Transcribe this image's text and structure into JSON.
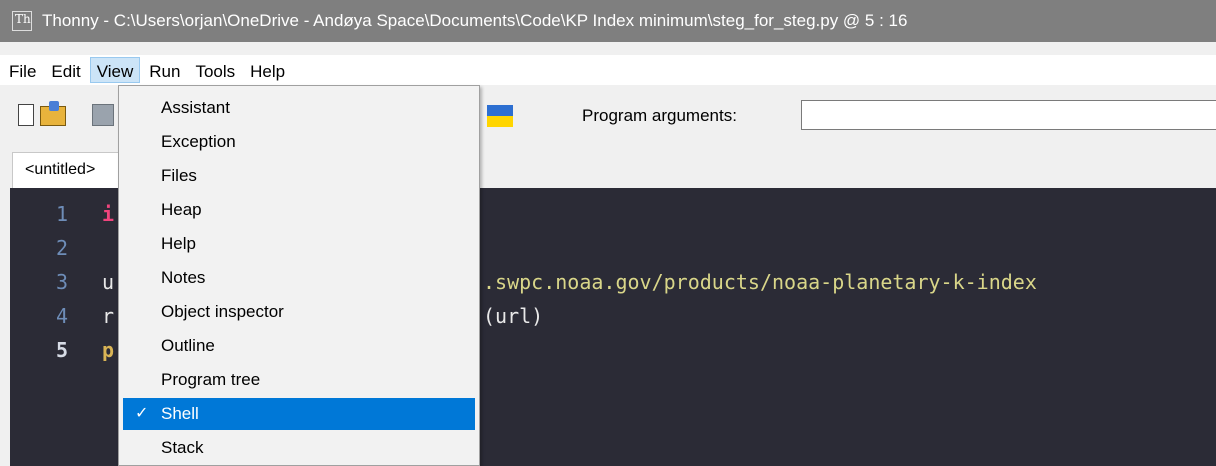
{
  "window": {
    "title": "Thonny  -  C:\\Users\\orjan\\OneDrive - Andøya Space\\Documents\\Code\\KP Index minimum\\steg_for_steg.py  @  5 : 16",
    "app_icon": "thonny-icon"
  },
  "menubar": {
    "items": [
      {
        "label": "File"
      },
      {
        "label": "Edit"
      },
      {
        "label": "View",
        "active": true
      },
      {
        "label": "Run"
      },
      {
        "label": "Tools"
      },
      {
        "label": "Help"
      }
    ]
  },
  "toolbar": {
    "icons": [
      "new-file-icon",
      "open-file-icon",
      "save-file-icon",
      "ukraine-flag-icon"
    ],
    "program_arguments_label": "Program arguments:",
    "program_arguments_value": ""
  },
  "tabs": [
    {
      "label": "<untitled>"
    }
  ],
  "editor": {
    "current_line": 5,
    "lines": [
      {
        "num": "1",
        "visible_text": "i"
      },
      {
        "num": "2",
        "visible_text": ""
      },
      {
        "num": "3",
        "visible_prefix": "u",
        "visible_text": ".swpc.noaa.gov/products/noaa-planetary-k-index"
      },
      {
        "num": "4",
        "visible_prefix": "r",
        "visible_text": "(url)"
      },
      {
        "num": "5",
        "visible_prefix": "p",
        "visible_text": ""
      }
    ]
  },
  "view_menu": {
    "items": [
      {
        "label": "Assistant",
        "checked": false
      },
      {
        "label": "Exception",
        "checked": false
      },
      {
        "label": "Files",
        "checked": false
      },
      {
        "label": "Heap",
        "checked": false
      },
      {
        "label": "Help",
        "checked": false
      },
      {
        "label": "Notes",
        "checked": false
      },
      {
        "label": "Object inspector",
        "checked": false
      },
      {
        "label": "Outline",
        "checked": false
      },
      {
        "label": "Program tree",
        "checked": false
      },
      {
        "label": "Shell",
        "checked": true,
        "highlighted": true
      },
      {
        "label": "Stack",
        "checked": false
      }
    ],
    "check_mark": "✓"
  },
  "colors": {
    "editor_bg": "#2b2b36",
    "keyword": "#f0447d",
    "string": "#d9d689",
    "line_numbers": "#6e8db8",
    "menu_highlight": "#0078d7"
  }
}
